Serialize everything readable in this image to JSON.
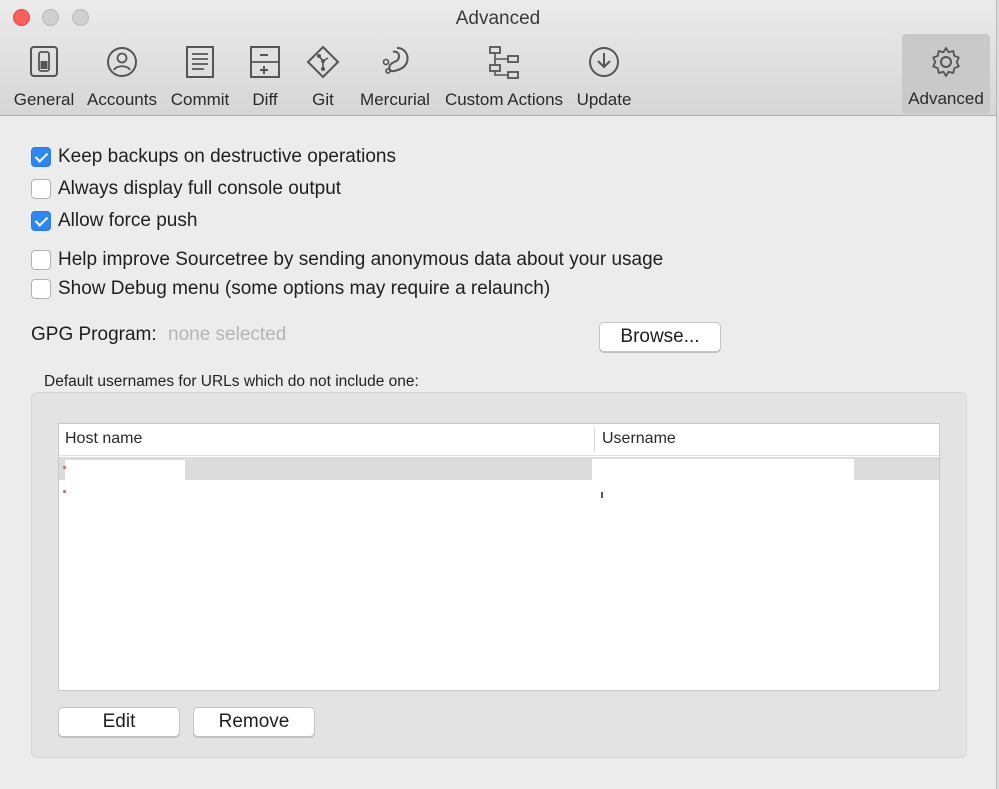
{
  "window": {
    "title": "Advanced"
  },
  "toolbar": {
    "items": [
      {
        "label": "General",
        "icon": "switch-icon"
      },
      {
        "label": "Accounts",
        "icon": "user-icon"
      },
      {
        "label": "Commit",
        "icon": "document-icon"
      },
      {
        "label": "Diff",
        "icon": "diff-icon"
      },
      {
        "label": "Git",
        "icon": "git-icon"
      },
      {
        "label": "Mercurial",
        "icon": "mercurial-icon"
      },
      {
        "label": "Custom Actions",
        "icon": "actions-icon"
      },
      {
        "label": "Update",
        "icon": "download-icon"
      },
      {
        "label": "Advanced",
        "icon": "gear-icon",
        "active": true
      }
    ]
  },
  "options": [
    {
      "label": "Keep backups on destructive operations",
      "checked": true
    },
    {
      "label": "Always display full console output",
      "checked": false
    },
    {
      "label": "Allow force push",
      "checked": true
    },
    {
      "label": "Help improve Sourcetree by sending anonymous data about your usage",
      "checked": false
    },
    {
      "label": "Show Debug menu (some options may require a relaunch)",
      "checked": false
    }
  ],
  "gpg": {
    "label": "GPG Program:",
    "value": "none selected",
    "browse_label": "Browse..."
  },
  "usernames": {
    "caption": "Default usernames for URLs which do not include one:",
    "columns": {
      "host": "Host name",
      "username": "Username"
    },
    "edit_label": "Edit",
    "remove_label": "Remove"
  },
  "colors": {
    "accent": "#2f87f5",
    "close": "#fc605b",
    "placeholder": "#b5b5b5"
  }
}
